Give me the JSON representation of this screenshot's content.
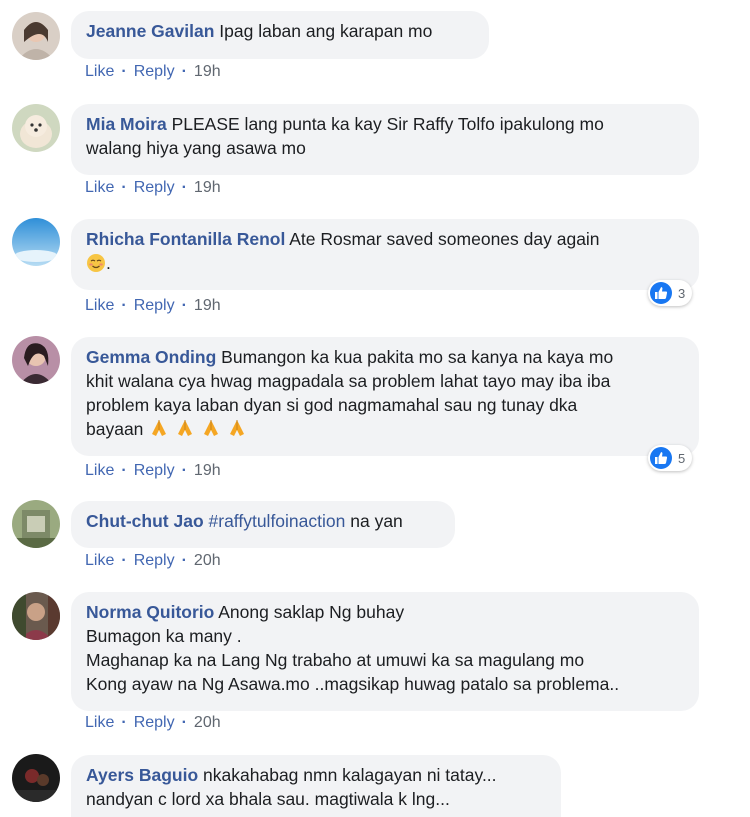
{
  "actions": {
    "like": "Like",
    "reply": "Reply",
    "separator": "·"
  },
  "comments": [
    {
      "author": "Jeanne Gavilan",
      "lines": [
        "Ipag laban ang karapan mo"
      ],
      "time": "19h"
    },
    {
      "author": "Mia Moira",
      "lines": [
        "PLEASE lang punta ka kay Sir Raffy Tolfo ipakulong mo",
        "walang hiya yang asawa mo"
      ],
      "time": "19h"
    },
    {
      "author": "Rhicha Fontanilla Renol",
      "lines": [
        "Ate Rosmar saved someones day again",
        "."
      ],
      "time": "19h",
      "reaction_icon": "like-icon",
      "reaction_count": "3",
      "inline_emoji": "relieved-face-emoji"
    },
    {
      "author": "Gemma Onding",
      "lines": [
        "Bumangon ka kua pakita mo sa kanya na kaya mo",
        "khit walana cya hwag magpadala sa problem lahat tayo may iba iba",
        "problem kaya laban dyan si god nagmamahal sau ng tunay dka",
        "bayaan"
      ],
      "time": "19h",
      "reaction_icon": "like-icon",
      "reaction_count": "5",
      "inline_emoji": "folded-hands-emoji x4"
    },
    {
      "author": "Chut-chut Jao",
      "hashtag": "#raffytulfoinaction",
      "lines": [
        "na yan"
      ],
      "time": "20h"
    },
    {
      "author": "Norma Quitorio",
      "lines": [
        "Anong saklap Ng buhay",
        "Bumagon ka many .",
        "Maghanap ka na Lang Ng trabaho at umuwi ka sa magulang mo",
        "Kong ayaw na Ng Asawa.mo ..magsikap huwag patalo sa problema.."
      ],
      "time": "20h"
    },
    {
      "author": "Ayers Baguio",
      "lines": [
        "nkakahabag nmn kalagayan ni tatay...",
        "nandyan c lord xa bhala sau. magtiwala k lng..."
      ]
    }
  ],
  "colors": {
    "author": "#385898",
    "link": "#4267b2",
    "bubble": "#f2f3f5",
    "like_badge": "#1877f2"
  }
}
